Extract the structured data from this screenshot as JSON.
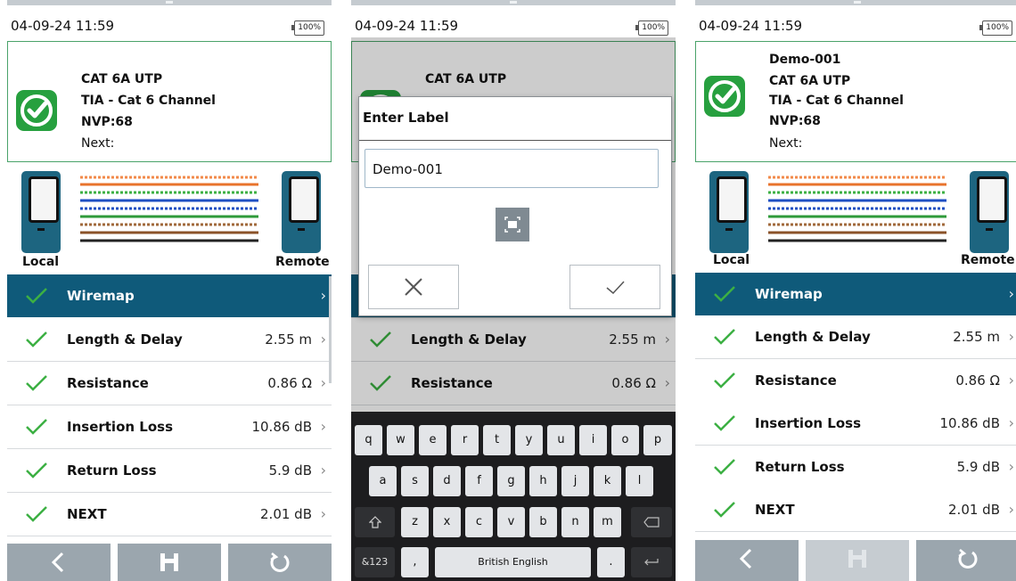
{
  "screens": [
    {
      "status": {
        "time": "04-09-24 11:59",
        "battery": "100%"
      },
      "summary": {
        "cable_type": "CAT 6A UTP",
        "standard": "TIA - Cat 6 Channel",
        "nvp": "NVP:68",
        "next": "Next:"
      },
      "ends": {
        "local": "Local",
        "remote": "Remote"
      },
      "tests": [
        {
          "label": "Wiremap",
          "value": ""
        },
        {
          "label": "Length & Delay",
          "value": "2.55 m"
        },
        {
          "label": "Resistance",
          "value": "0.86 Ω"
        },
        {
          "label": "Insertion Loss",
          "value": "10.86 dB"
        },
        {
          "label": "Return Loss",
          "value": "5.9 dB"
        },
        {
          "label": "NEXT",
          "value": "2.01 dB"
        }
      ],
      "icons": {
        "chevron": "›"
      }
    },
    {
      "status": {
        "time": "04-09-24 11:59",
        "battery": "100%"
      },
      "summary": {
        "cable_type": "CAT 6A UTP"
      },
      "dialog": {
        "title": "Enter Label",
        "value": "Demo-001"
      },
      "tests": [
        {
          "label": "Length & Delay",
          "value": "2.55 m"
        },
        {
          "label": "Resistance",
          "value": "0.86 Ω"
        }
      ],
      "keyboard": {
        "row1": [
          "q",
          "w",
          "e",
          "r",
          "t",
          "y",
          "u",
          "i",
          "o",
          "p"
        ],
        "row2": [
          "a",
          "s",
          "d",
          "f",
          "g",
          "h",
          "j",
          "k",
          "l"
        ],
        "row3": [
          "z",
          "x",
          "c",
          "v",
          "b",
          "n",
          "m"
        ],
        "numbers_key": "&123",
        "comma": ",",
        "space": "British English",
        "period": "."
      }
    },
    {
      "status": {
        "time": "04-09-24 11:59",
        "battery": "100%"
      },
      "summary": {
        "label": "Demo-001",
        "cable_type": "CAT 6A UTP",
        "standard": "TIA - Cat 6 Channel",
        "nvp": "NVP:68",
        "next": "Next:"
      },
      "ends": {
        "local": "Local",
        "remote": "Remote"
      },
      "tests": [
        {
          "label": "Wiremap",
          "value": ""
        },
        {
          "label": "Length & Delay",
          "value": "2.55 m"
        },
        {
          "label": "Resistance",
          "value": "0.86 Ω"
        },
        {
          "label": "Insertion Loss",
          "value": "10.86 dB"
        },
        {
          "label": "Return Loss",
          "value": "5.9 dB"
        },
        {
          "label": "NEXT",
          "value": "2.01 dB"
        }
      ]
    }
  ],
  "colors": {
    "accent": "#0f5a7a",
    "pass": "#27a03f",
    "summary_border": "#4aa36a",
    "nav_button": "#9ba6ae"
  }
}
